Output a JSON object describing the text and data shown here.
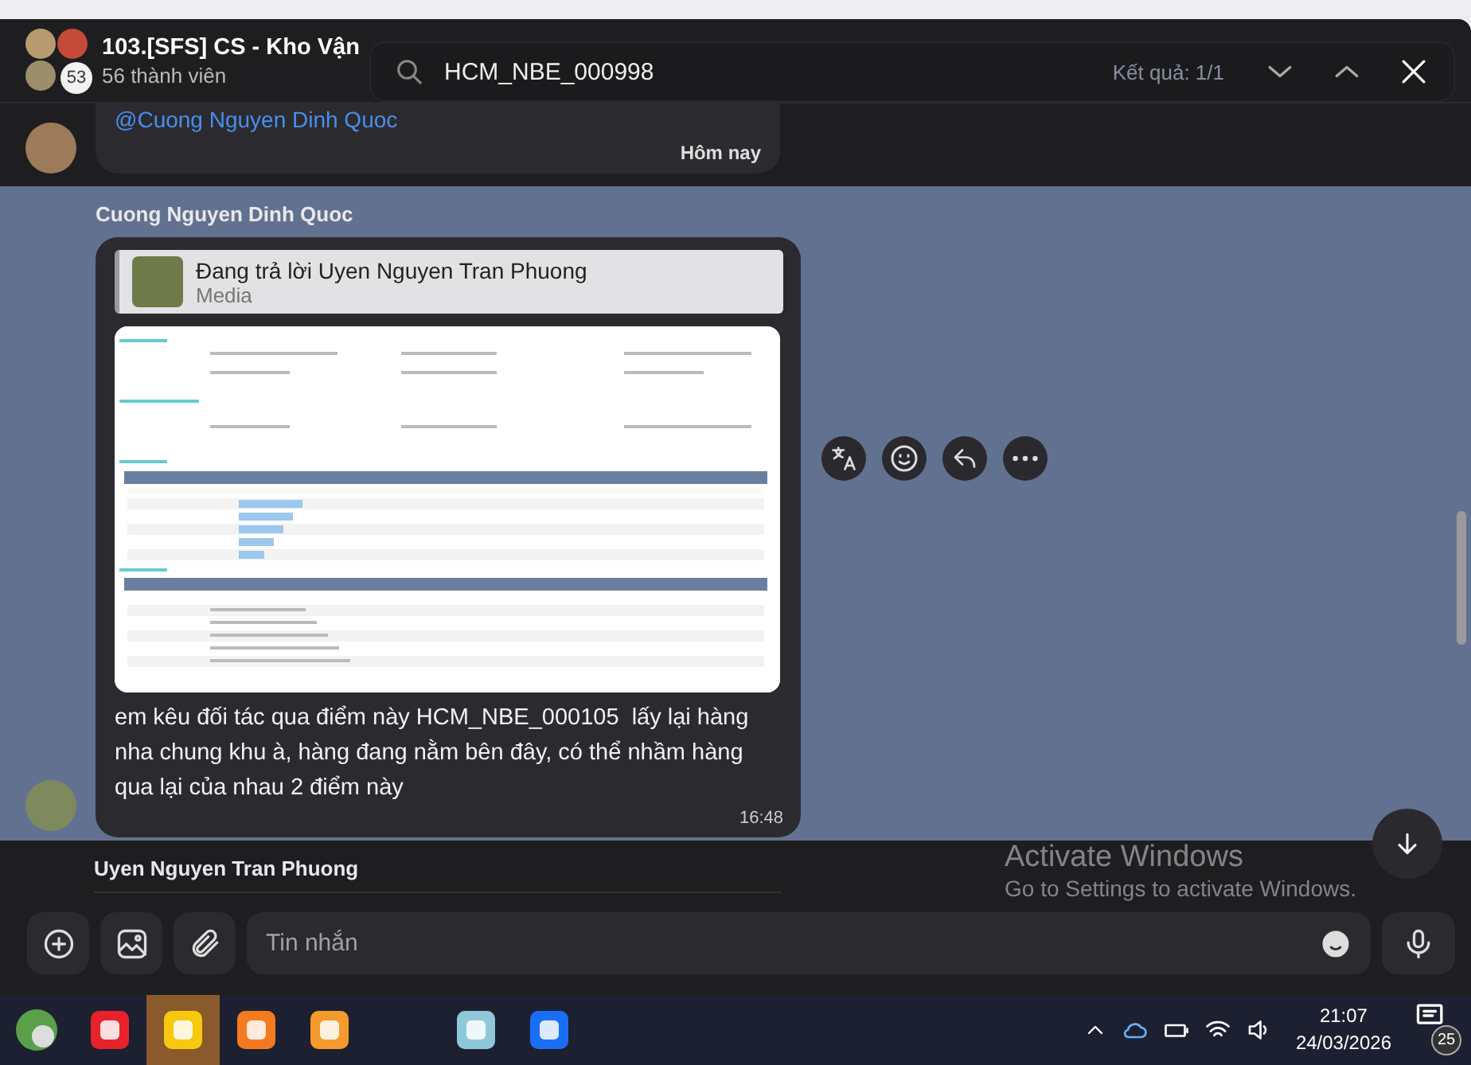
{
  "header": {
    "avatar_badge": "53",
    "title": "103.[SFS] CS - Kho Vận",
    "members": "56 thành viên"
  },
  "search": {
    "value": "HCM_NBE_000998",
    "result": "Kết quả: 1/1"
  },
  "messages": [
    {
      "kind": "partial",
      "mention": "@Cuong Nguyen Dinh Quoc",
      "time": "Hôm nay",
      "highlighted": false
    },
    {
      "kind": "reply",
      "sender": "Cuong Nguyen Dinh Quoc",
      "reply_title": "Đang trả lời Uyen Nguyen Tran Phuong",
      "reply_type": "Media",
      "text": "em kêu đối tác qua điểm này HCM_NBE_000105  lấy lại hàng nha chung khu à, hàng đang nằm bên đây, có thể nhầm hàng qua lại của nhau 2 điểm này",
      "time": "16:48",
      "highlighted": true
    },
    {
      "kind": "sender_only",
      "sender": "Uyen Nguyen Tran Phuong",
      "highlighted": false
    }
  ],
  "composer": {
    "placeholder": "Tin nhắn"
  },
  "watermark": {
    "title": "Activate Windows",
    "subtitle": "Go to Settings to activate Windows."
  },
  "taskbar": {
    "time": "21:07",
    "date": "24/03/2026",
    "notifications": "25"
  }
}
